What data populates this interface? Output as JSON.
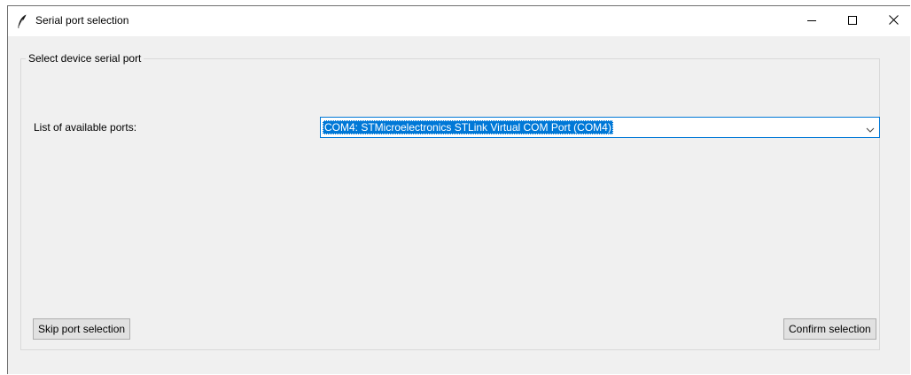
{
  "window": {
    "title": "Serial port selection",
    "icon": "feather-icon",
    "controls": {
      "minimize": "minimize-icon",
      "maximize": "maximize-icon",
      "close": "close-icon"
    }
  },
  "group": {
    "label": "Select device serial port"
  },
  "ports": {
    "label": "List of available ports:",
    "selected": "COM4: STMicroelectronics STLink Virtual COM Port (COM4)"
  },
  "buttons": {
    "skip_label": "Skip port selection",
    "confirm_label": "Confirm selection"
  },
  "colors": {
    "accent": "#0078d7",
    "window_bg": "#f0f0f0"
  }
}
